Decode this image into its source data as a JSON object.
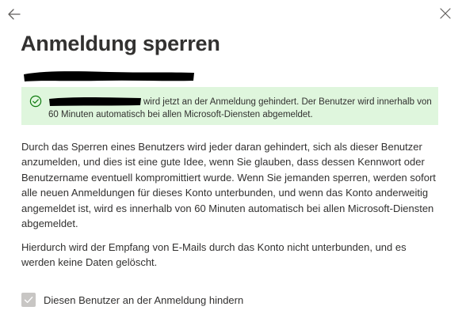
{
  "panel": {
    "title": "Anmeldung sperren"
  },
  "notice": {
    "text": "wird jetzt an der Anmeldung gehindert. Der Benutzer wird innerhalb von 60 Minuten automatisch bei allen Microsoft-Diensten abgemeldet.",
    "icon": "checkmark-circle-icon",
    "bg_color": "#dff6dd",
    "icon_color": "#107c10"
  },
  "body": {
    "paragraph1": "Durch das Sperren eines Benutzers wird jeder daran gehindert, sich als dieser Benutzer anzumelden, und dies ist eine gute Idee, wenn Sie glauben, dass dessen Kennwort oder Benutzername eventuell kompromittiert wurde. Wenn Sie jemanden sperren, werden sofort alle neuen Anmeldungen für dieses Konto unterbunden, und wenn das Konto anderweitig angemeldet ist, wird es innerhalb von 60 Minuten automatisch bei allen Microsoft-Diensten abgemeldet.",
    "paragraph2": "Hierdurch wird der Empfang von E-Mails durch das Konto nicht unterbunden, und es werden keine Daten gelöscht."
  },
  "option": {
    "label": "Diesen Benutzer an der Anmeldung hindern",
    "checked": true,
    "disabled": true
  },
  "icons": {
    "back": "back-arrow-icon",
    "close": "close-icon",
    "checkbox": "checkmark-icon"
  }
}
